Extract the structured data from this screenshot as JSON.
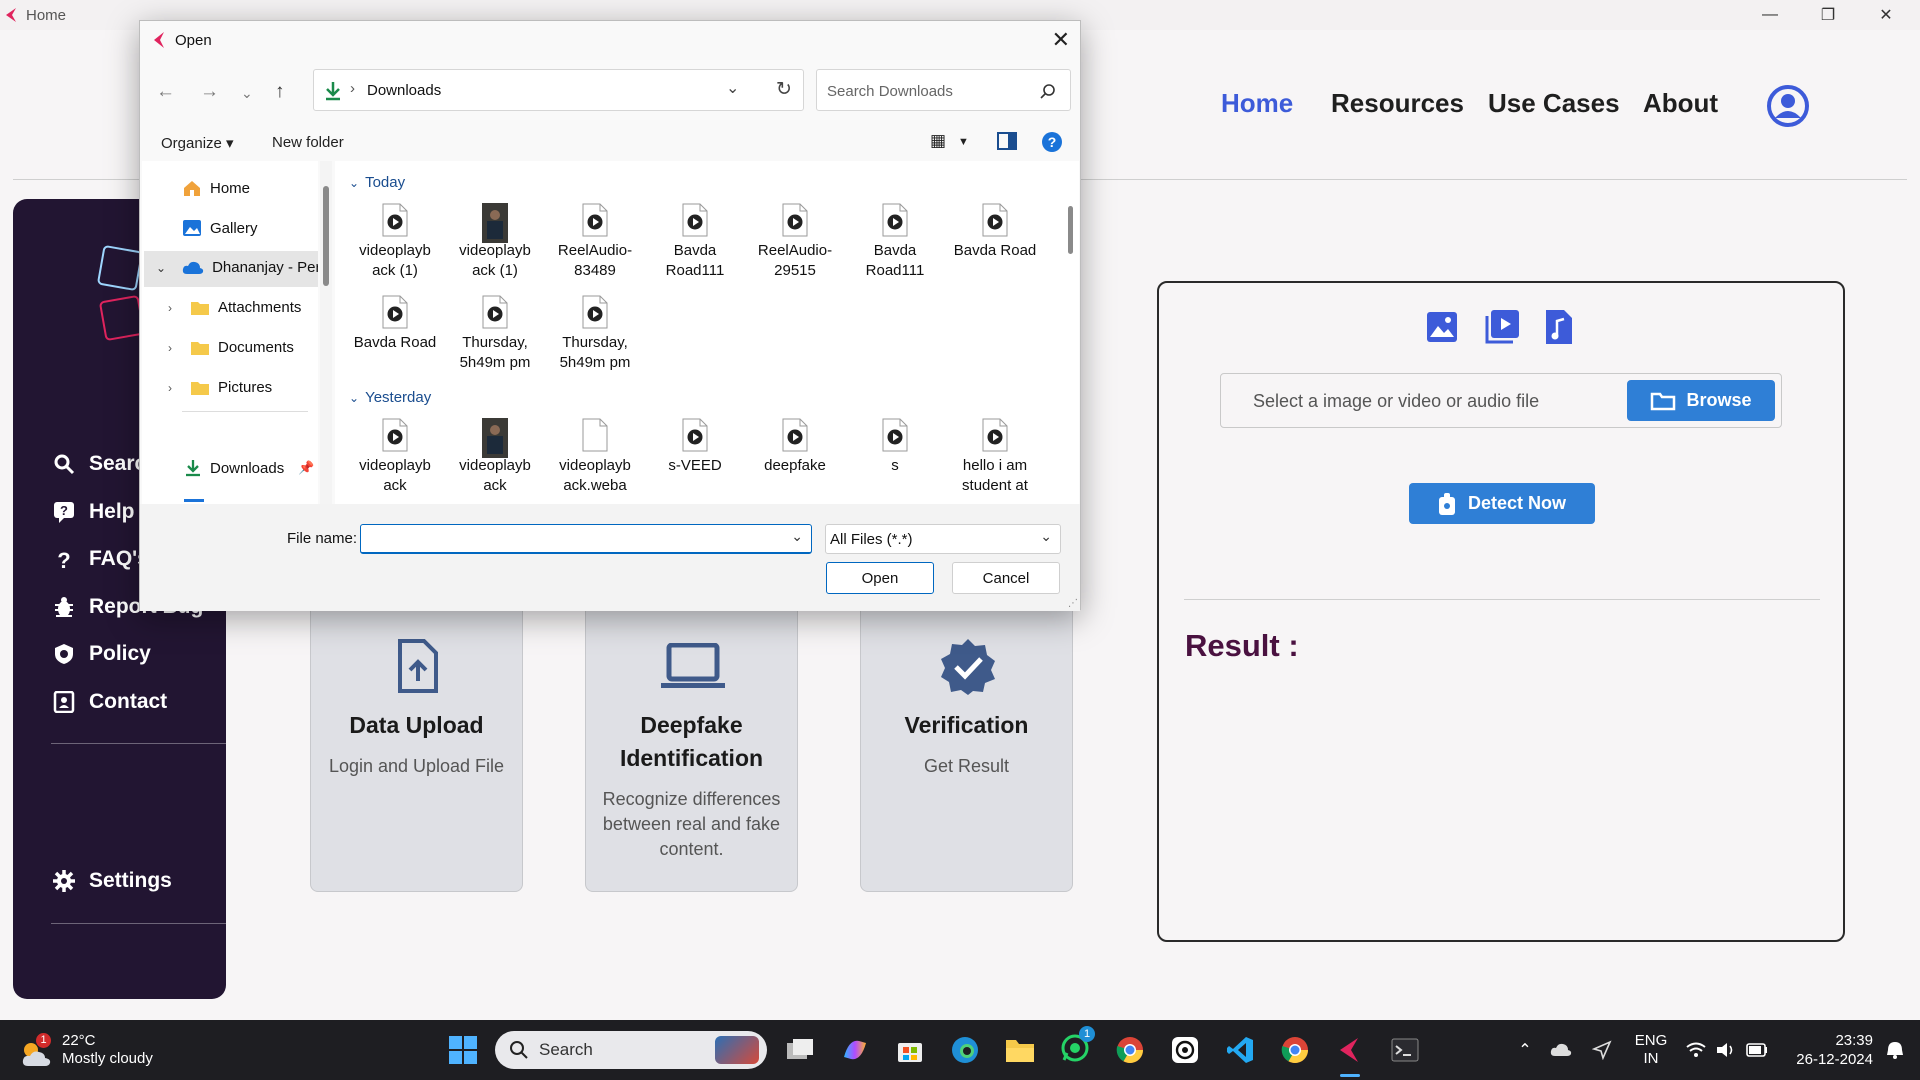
{
  "window": {
    "title": "Home"
  },
  "nav": {
    "home": "Home",
    "resources": "Resources",
    "use_cases": "Use Cases",
    "about": "About"
  },
  "colors": {
    "accent": "#2f7fd6",
    "nav_active": "#3d5bd9",
    "sidebar_bg": "#221532",
    "result_color": "#4a1140"
  },
  "sidebar": {
    "items": [
      {
        "label": "Search",
        "icon": "search-icon"
      },
      {
        "label": "Help",
        "icon": "help-icon"
      },
      {
        "label": "FAQ's",
        "icon": "question-icon"
      },
      {
        "label": "Report Bug",
        "icon": "bug-icon"
      },
      {
        "label": "Policy",
        "icon": "shield-icon"
      },
      {
        "label": "Contact",
        "icon": "contact-icon"
      }
    ],
    "settings": "Settings"
  },
  "cards": [
    {
      "title": "Data Upload",
      "subtitle": "Login and Upload File"
    },
    {
      "title": "Deepfake Identification",
      "subtitle": "Recognize differences between real and fake content."
    },
    {
      "title": "Verification",
      "subtitle": "Get Result"
    }
  ],
  "panel": {
    "placeholder": "Select a image or video or audio file",
    "browse": "Browse",
    "detect": "Detect Now",
    "result": "Result :"
  },
  "dialog": {
    "title": "Open",
    "path": "Downloads",
    "search_placeholder": "Search Downloads",
    "organize": "Organize",
    "new_folder": "New folder",
    "nav_pane": {
      "home": "Home",
      "gallery": "Gallery",
      "onedrive": "Dhananjay - Pers",
      "attachments": "Attachments",
      "documents": "Documents",
      "pictures": "Pictures",
      "downloads": "Downloads"
    },
    "groups": {
      "today": "Today",
      "yesterday": "Yesterday"
    },
    "today_files": [
      {
        "name": "videoplayb ack (1)",
        "kind": "media"
      },
      {
        "name": "videoplayb ack (1)",
        "kind": "thumb"
      },
      {
        "name": "ReelAudio- 83489",
        "kind": "media"
      },
      {
        "name": "Bavda Road111",
        "kind": "media"
      },
      {
        "name": "ReelAudio- 29515",
        "kind": "media"
      },
      {
        "name": "Bavda Road111",
        "kind": "media"
      },
      {
        "name": "Bavda Road",
        "kind": "media"
      },
      {
        "name": "Bavda Road",
        "kind": "media"
      },
      {
        "name": "Thursday, 5h49m pm",
        "kind": "media"
      },
      {
        "name": "Thursday, 5h49m pm",
        "kind": "media"
      }
    ],
    "yesterday_files": [
      {
        "name": "videoplayb ack",
        "kind": "media"
      },
      {
        "name": "videoplayb ack",
        "kind": "thumb"
      },
      {
        "name": "videoplayb ack.weba",
        "kind": "blank"
      },
      {
        "name": "s-VEED",
        "kind": "media"
      },
      {
        "name": "deepfake",
        "kind": "media"
      },
      {
        "name": "s",
        "kind": "media"
      },
      {
        "name": "hello i am student at",
        "kind": "media"
      }
    ],
    "file_name_label": "File name:",
    "file_name_value": "",
    "file_type": "All Files (*.*)",
    "open": "Open",
    "cancel": "Cancel"
  },
  "taskbar": {
    "weather_temp": "22°C",
    "weather_desc": "Mostly cloudy",
    "weather_badge": "1",
    "search": "Search",
    "whatsapp_badge": "1",
    "lang1": "ENG",
    "lang2": "IN",
    "time": "23:39",
    "date": "26-12-2024"
  }
}
